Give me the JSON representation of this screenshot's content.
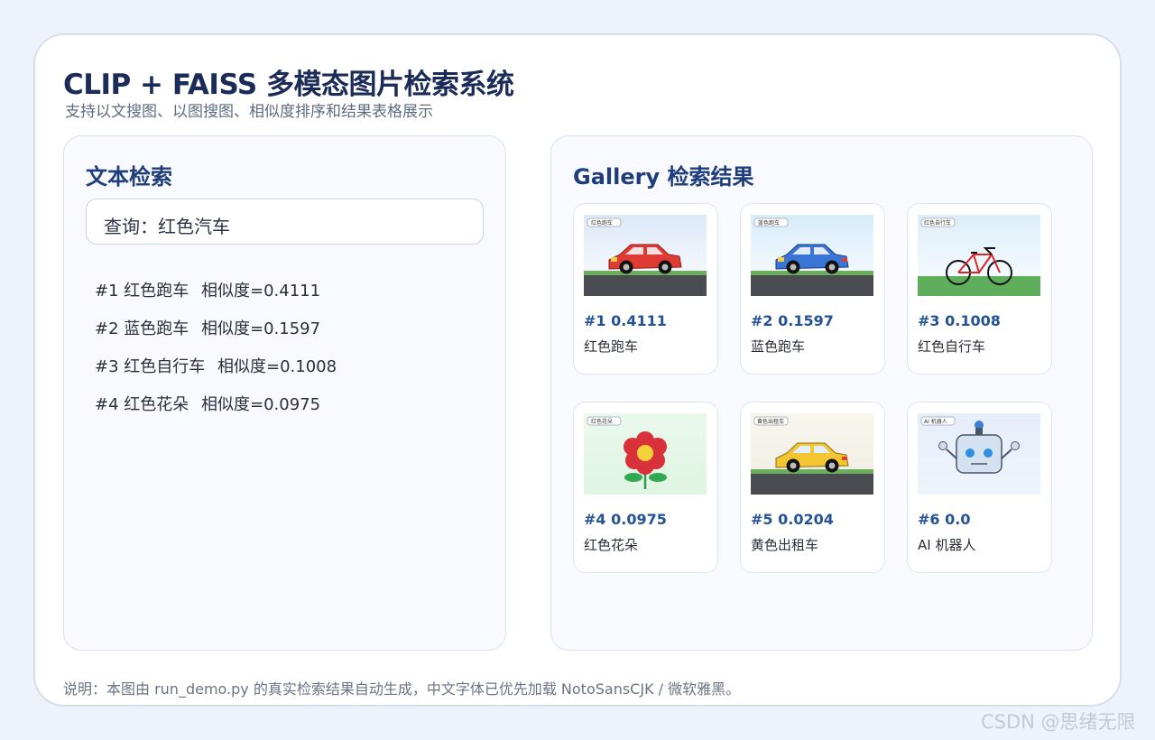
{
  "header": {
    "title": "CLIP + FAISS 多模态图片检索系统",
    "subtitle": "支持以文搜图、以图搜图、相似度排序和结果表格展示"
  },
  "text_search": {
    "panel_title": "文本检索",
    "query": "查询：红色汽车",
    "results": [
      {
        "rank": "#1",
        "name": "红色跑车",
        "score": "相似度=0.4111"
      },
      {
        "rank": "#2",
        "name": "蓝色跑车",
        "score": "相似度=0.1597"
      },
      {
        "rank": "#3",
        "name": "红色自行车",
        "score": "相似度=0.1008"
      },
      {
        "rank": "#4",
        "name": "红色花朵",
        "score": "相似度=0.0975"
      }
    ]
  },
  "gallery": {
    "panel_title": "Gallery 检索结果",
    "items": [
      {
        "score": "#1 0.4111",
        "label": "红色跑车",
        "tag": "红色跑车",
        "kind": "car",
        "color": "#e03a34"
      },
      {
        "score": "#2 0.1597",
        "label": "蓝色跑车",
        "tag": "蓝色跑车",
        "kind": "car",
        "color": "#3a74d6"
      },
      {
        "score": "#3 0.1008",
        "label": "红色自行车",
        "tag": "红色自行车",
        "kind": "bike",
        "color": "#d8262a"
      },
      {
        "score": "#4 0.0975",
        "label": "红色花朵",
        "tag": "红色花朵",
        "kind": "flower",
        "color": "#d8313a"
      },
      {
        "score": "#5 0.0204",
        "label": "黄色出租车",
        "tag": "黄色出租车",
        "kind": "car",
        "color": "#f2c531"
      },
      {
        "score": "#6 0.0",
        "label": "AI 机器人",
        "tag": "AI 机器人",
        "kind": "robot",
        "color": "#d4e1f0"
      }
    ]
  },
  "footnote": "说明：本图由 run_demo.py 的真实检索结果自动生成，中文字体已优先加载 NotoSansCJK / 微软雅黑。",
  "watermark": "CSDN @思绪无限"
}
